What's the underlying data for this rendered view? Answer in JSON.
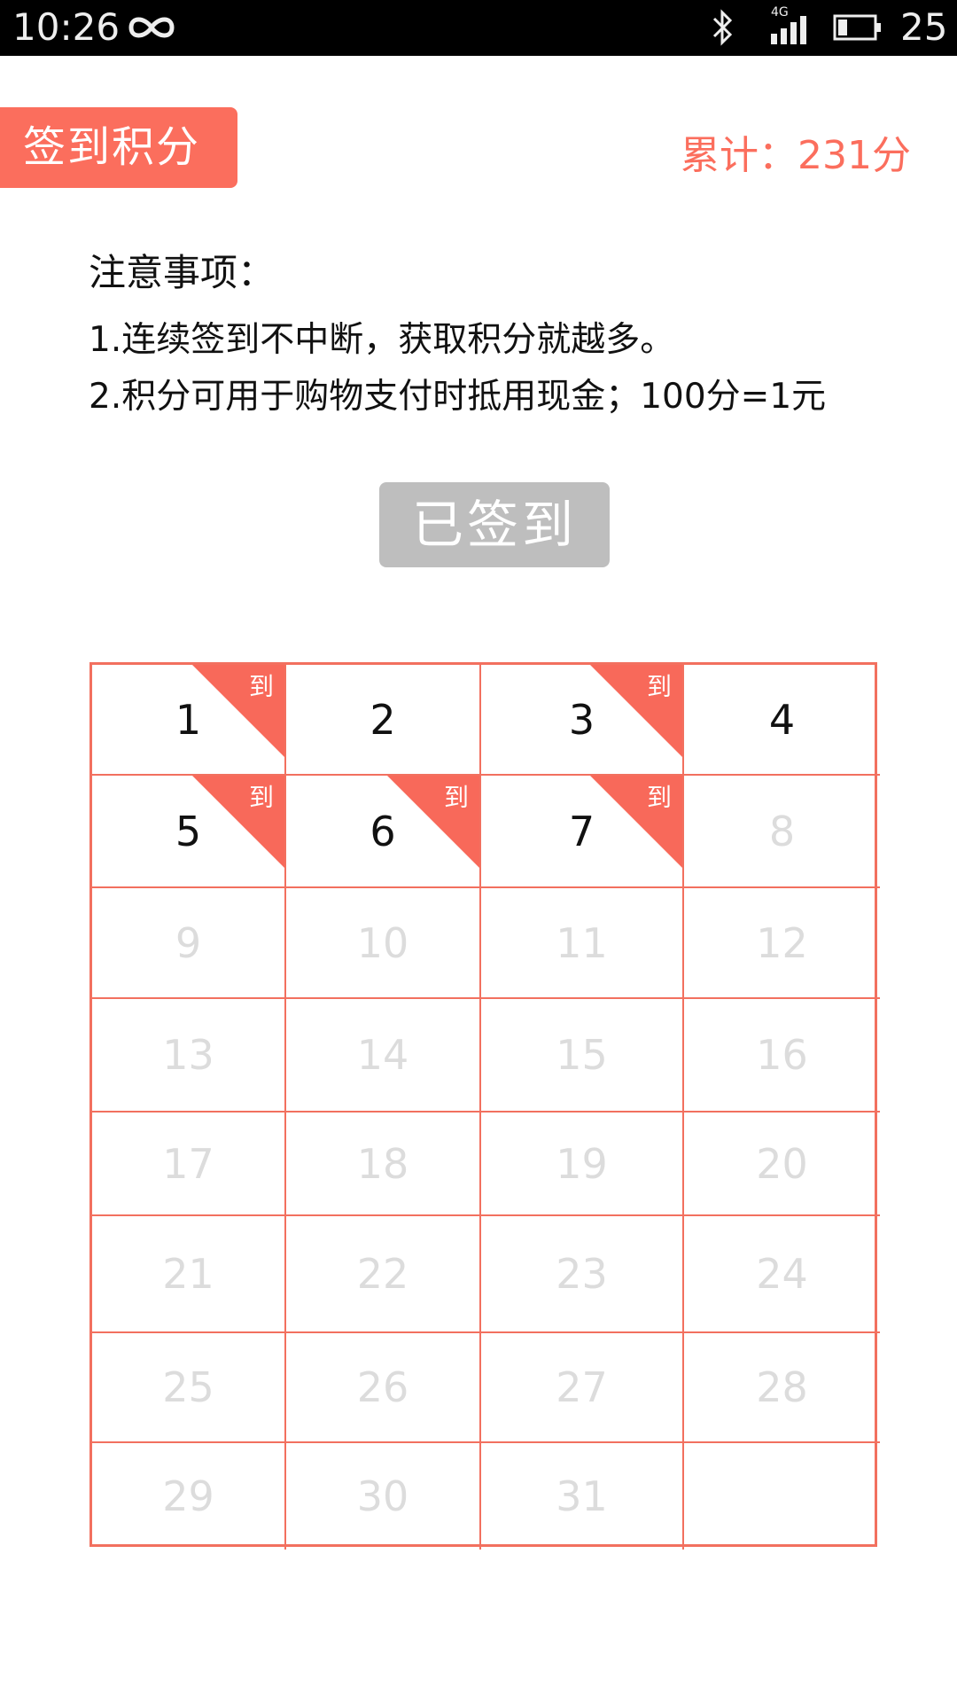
{
  "status_bar": {
    "time": "10:26",
    "network": "4G",
    "battery_level": "25",
    "icons": [
      "infinity-icon",
      "bluetooth-icon",
      "signal-icon",
      "battery-icon"
    ]
  },
  "header": {
    "title": "签到积分",
    "total": "累计：231分"
  },
  "notes": {
    "heading": "注意事项：",
    "items": [
      "1.连续签到不中断，获取积分就越多。",
      "2.积分可用于购物支付时抵用现金；100分=1元"
    ]
  },
  "checkin_button": {
    "label": "已签到"
  },
  "calendar": {
    "checked_label": "到",
    "days": [
      {
        "day": "1",
        "checked": true,
        "done": true
      },
      {
        "day": "2",
        "checked": false,
        "done": true
      },
      {
        "day": "3",
        "checked": true,
        "done": true
      },
      {
        "day": "4",
        "checked": false,
        "done": true
      },
      {
        "day": "5",
        "checked": true,
        "done": true
      },
      {
        "day": "6",
        "checked": true,
        "done": true
      },
      {
        "day": "7",
        "checked": true,
        "done": true
      },
      {
        "day": "8",
        "checked": false,
        "done": false
      },
      {
        "day": "9",
        "checked": false,
        "done": false
      },
      {
        "day": "10",
        "checked": false,
        "done": false
      },
      {
        "day": "11",
        "checked": false,
        "done": false
      },
      {
        "day": "12",
        "checked": false,
        "done": false
      },
      {
        "day": "13",
        "checked": false,
        "done": false
      },
      {
        "day": "14",
        "checked": false,
        "done": false
      },
      {
        "day": "15",
        "checked": false,
        "done": false
      },
      {
        "day": "16",
        "checked": false,
        "done": false
      },
      {
        "day": "17",
        "checked": false,
        "done": false
      },
      {
        "day": "18",
        "checked": false,
        "done": false
      },
      {
        "day": "19",
        "checked": false,
        "done": false
      },
      {
        "day": "20",
        "checked": false,
        "done": false
      },
      {
        "day": "21",
        "checked": false,
        "done": false
      },
      {
        "day": "22",
        "checked": false,
        "done": false
      },
      {
        "day": "23",
        "checked": false,
        "done": false
      },
      {
        "day": "24",
        "checked": false,
        "done": false
      },
      {
        "day": "25",
        "checked": false,
        "done": false
      },
      {
        "day": "26",
        "checked": false,
        "done": false
      },
      {
        "day": "27",
        "checked": false,
        "done": false
      },
      {
        "day": "28",
        "checked": false,
        "done": false
      },
      {
        "day": "29",
        "checked": false,
        "done": false
      },
      {
        "day": "30",
        "checked": false,
        "done": false
      },
      {
        "day": "31",
        "checked": false,
        "done": false
      },
      {
        "day": "",
        "checked": false,
        "done": false
      }
    ]
  },
  "colors": {
    "accent": "#fb6e5d",
    "grid_line": "#f2705f",
    "disabled_button": "#bebebe",
    "future_day_text": "#dcdcdc"
  }
}
